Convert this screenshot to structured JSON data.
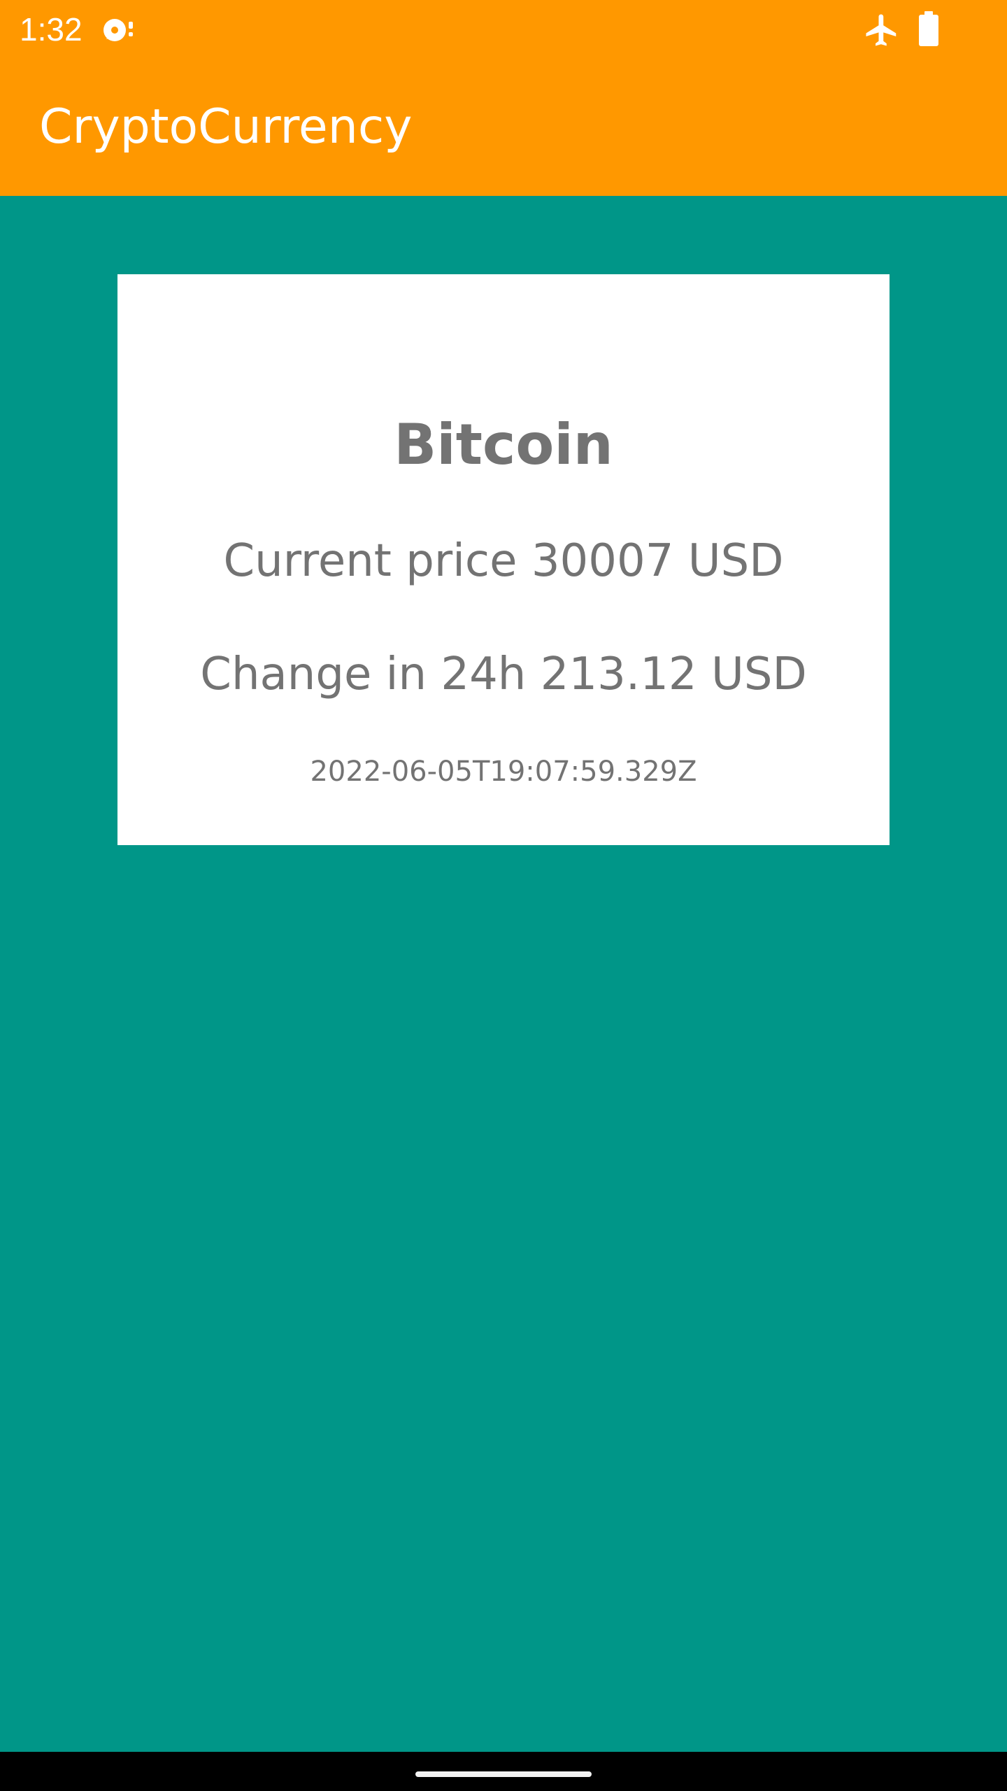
{
  "status_bar": {
    "time": "1:32",
    "icons": [
      "notification-icon",
      "airplane-icon",
      "battery-icon"
    ],
    "background": "#FF9800"
  },
  "app_bar": {
    "title": "CryptoCurrency",
    "background": "#FF9800"
  },
  "content": {
    "background": "#009688"
  },
  "card": {
    "title": "Bitcoin",
    "price_line": "Current price 30007 USD",
    "change_line": "Change in 24h 213.12 USD",
    "timestamp": "2022-06-05T19:07:59.329Z"
  }
}
